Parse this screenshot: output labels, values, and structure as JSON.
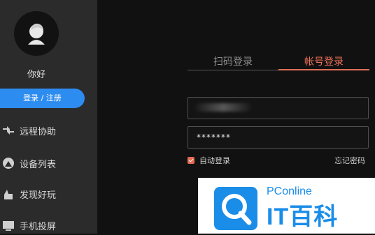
{
  "sidebar": {
    "greeting": "你好",
    "login_button": "登录 / 注册",
    "items": [
      {
        "label": "远程协助",
        "icon": "remote-assist-icon"
      },
      {
        "label": "设备列表",
        "icon": "device-list-icon"
      },
      {
        "label": "发现好玩",
        "icon": "discover-icon"
      },
      {
        "label": "手机投屏",
        "icon": "phone-cast-icon"
      }
    ]
  },
  "login": {
    "tabs": [
      {
        "label": "扫码登录",
        "active": false
      },
      {
        "label": "帐号登录",
        "active": true
      }
    ],
    "password_value": "*******",
    "remember_label": "自动登录",
    "remember_checked": true,
    "forgot_label": "忘记密码"
  },
  "watermark": {
    "brand_small": "PConline",
    "brand_large": "IT百科"
  },
  "colors": {
    "sidebar_bg": "#2b2b2b",
    "main_bg": "#111111",
    "accent_blue": "#2d8cf0",
    "accent_orange": "#e0705a"
  }
}
